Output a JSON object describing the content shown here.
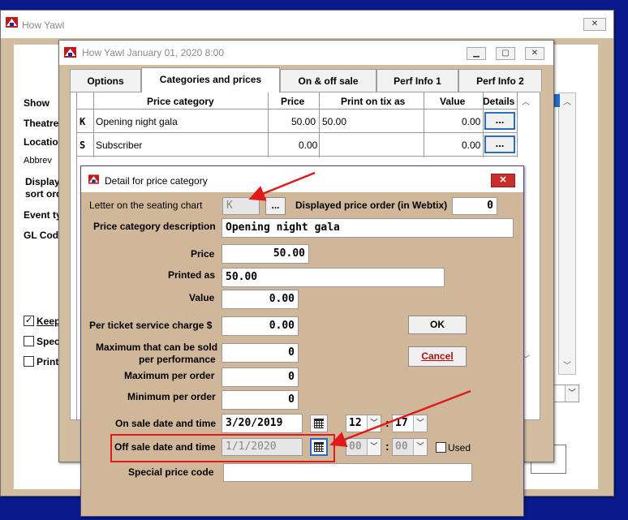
{
  "main_window": {
    "title": "How Yawl",
    "labels": {
      "show": "Show",
      "theatre": "Theatre",
      "location": "Location",
      "abbrev": "Abbrev",
      "display": "Display",
      "sort_order": "sort ord",
      "event_type": "Event ty",
      "gl_code": "GL Code"
    },
    "checkboxes": [
      {
        "label": "Keep",
        "checked": true
      },
      {
        "label": "Spec",
        "checked": false
      },
      {
        "label": "Print",
        "checked": false
      }
    ]
  },
  "perf_window": {
    "title": "How Yawl January 01, 2020 8:00",
    "tabs": [
      {
        "label": "Options",
        "active": false
      },
      {
        "label": "Categories and prices",
        "active": true
      },
      {
        "label": "On & off sale",
        "active": false
      },
      {
        "label": "Perf Info 1",
        "active": false
      },
      {
        "label": "Perf Info 2",
        "active": false
      }
    ],
    "grid": {
      "headers": {
        "price_category": "Price category",
        "price": "Price",
        "print_on_tix_as": "Print on tix as",
        "value": "Value",
        "details": "Details"
      },
      "rows": [
        {
          "letter": "K",
          "category": "Opening night gala",
          "price": "50.00",
          "print_as": "50.00",
          "value": "0.00",
          "details": "..."
        },
        {
          "letter": "S",
          "category": "Subscriber",
          "price": "0.00",
          "print_as": "",
          "value": "0.00",
          "details": "..."
        }
      ]
    }
  },
  "dialog": {
    "title": "Detail for price category",
    "close_icon": "close-x-icon",
    "letter_label": "Letter on the seating chart",
    "letter_value": "K",
    "letter_button": "...",
    "display_order_label": "Displayed price order (in Webtix)",
    "display_order_value": "0",
    "description_label": "Price category description",
    "description_value": "Opening night gala",
    "price_label": "Price",
    "price_value": "50.00",
    "printed_as_label": "Printed as",
    "printed_as_value": "50.00",
    "value_label": "Value",
    "value_value": "0.00",
    "service_charge_label": "Per ticket service charge $",
    "service_charge_value": "0.00",
    "max_per_perf_label_1": "Maximum that can be sold",
    "max_per_perf_label_2": "per performance",
    "max_per_perf_value": "0",
    "max_per_order_label": "Maximum per order",
    "max_per_order_value": "0",
    "min_per_order_label": "Minimum per order",
    "min_per_order_value": "0",
    "on_sale_label": "On sale date and time",
    "on_sale_date": "3/20/2019",
    "on_sale_hour": "12",
    "on_sale_minute": "17",
    "off_sale_label": "Off sale date and time",
    "off_sale_date": "1/1/2020",
    "off_sale_hour": "00",
    "off_sale_minute": "00",
    "used_label": "Used",
    "used_checked": false,
    "special_code_label": "Special price code",
    "special_code_value": "",
    "ok_button": "OK",
    "cancel_button": "Cancel",
    "time_separator": ":"
  },
  "colors": {
    "desktop": "#0a1a8c",
    "panel": "#d3bda0",
    "dialog_panel": "#d0b79a",
    "annotation": "#e01919",
    "focus_blue": "#2a6cc4"
  }
}
